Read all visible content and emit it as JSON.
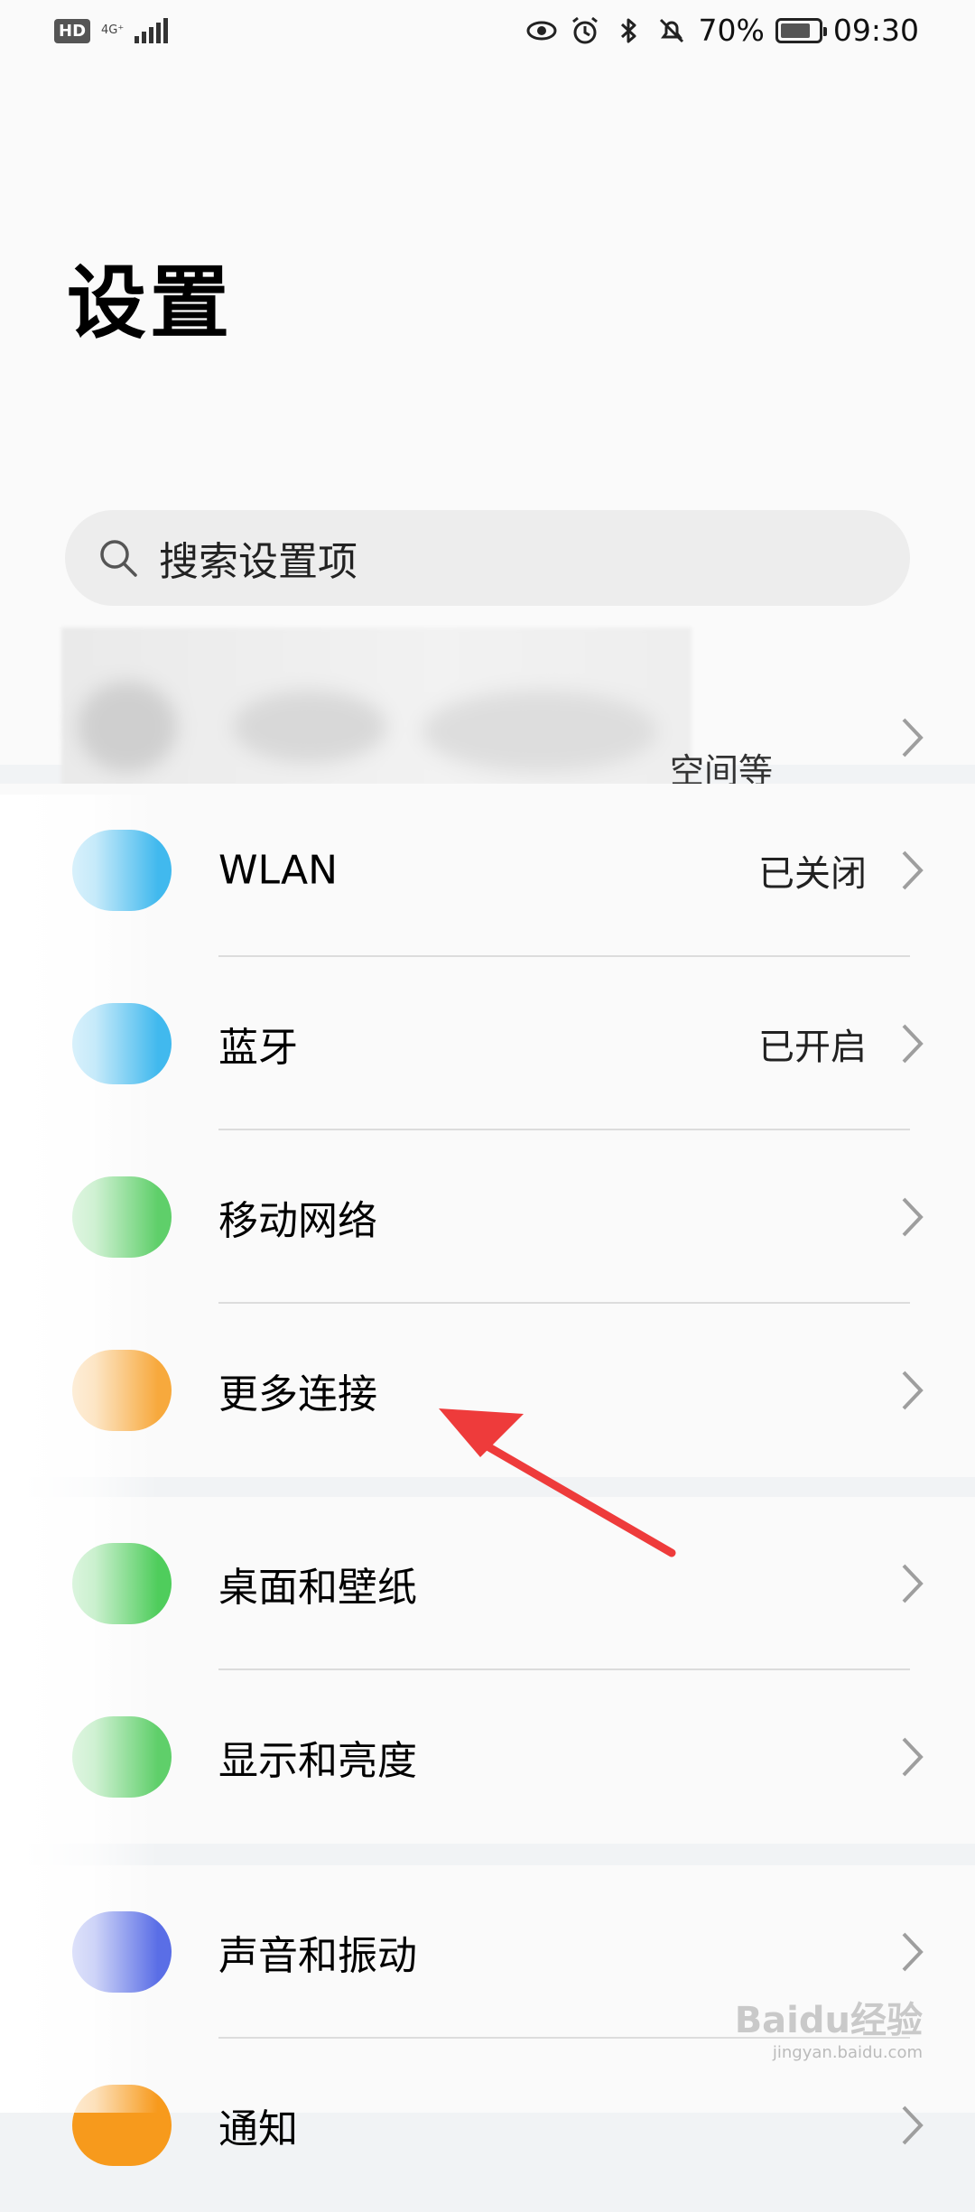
{
  "status_bar": {
    "hd_badge": "HD",
    "network_type": "4G⁺",
    "battery_percent": "70%",
    "time": "09:30",
    "icons": [
      "eye-comfort-icon",
      "alarm-icon",
      "bluetooth-icon",
      "mute-icon",
      "battery-icon"
    ]
  },
  "header": {
    "title": "设置"
  },
  "search": {
    "placeholder": "搜索设置项"
  },
  "account": {
    "subtitle_fragment": "空间等"
  },
  "groups": [
    {
      "items": [
        {
          "label": "WLAN",
          "status": "已关闭",
          "icon_color": "#41b9ee"
        },
        {
          "label": "蓝牙",
          "status": "已开启",
          "icon_color": "#41b9ee"
        },
        {
          "label": "移动网络",
          "status": "",
          "icon_color": "#5fcf6a"
        },
        {
          "label": "更多连接",
          "status": "",
          "icon_color": "#f7a93d"
        }
      ]
    },
    {
      "items": [
        {
          "label": "桌面和壁纸",
          "status": "",
          "icon_color": "#4fcd5c"
        },
        {
          "label": "显示和亮度",
          "status": "",
          "icon_color": "#5fcf6a"
        }
      ]
    },
    {
      "items": [
        {
          "label": "声音和振动",
          "status": "",
          "icon_color": "#5a6ee6"
        },
        {
          "label": "通知",
          "status": "",
          "icon_color": "#f79a1c"
        }
      ]
    }
  ],
  "watermark": {
    "brand": "Baidu经验",
    "url": "jingyan.baidu.com"
  },
  "colors": {
    "arrow": "#ee3b3b",
    "chevron": "#9e9e9e"
  }
}
